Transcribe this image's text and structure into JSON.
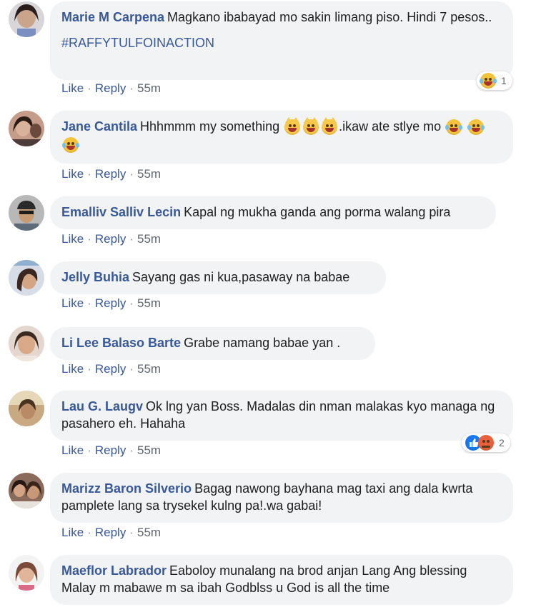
{
  "comments": [
    {
      "author": "Marie M Carpena",
      "text": "Magkano ibabayad mo sakin limang piso. Hindi 7 pesos..",
      "hashtag": "#RAFFYTULFOINACTION",
      "like": "Like",
      "reply": "Reply",
      "time": "55m",
      "reaction_count": "1"
    },
    {
      "author": "Jane Cantila",
      "text": "Hhhmmm my something",
      "text2": ".ikaw ate stlye mo",
      "like": "Like",
      "reply": "Reply",
      "time": "55m"
    },
    {
      "author": "Emalliv Salliv Lecin",
      "text": "Kapal ng mukha ganda ang porma walang pira",
      "like": "Like",
      "reply": "Reply",
      "time": "55m"
    },
    {
      "author": "Jelly Buhia",
      "text": "Sayang gas ni kua,pasaway na babae",
      "like": "Like",
      "reply": "Reply",
      "time": "55m"
    },
    {
      "author": "Li Lee Balaso Barte",
      "text": "Grabe namang babae yan .",
      "like": "Like",
      "reply": "Reply",
      "time": "55m"
    },
    {
      "author": "Lau G. Laugv",
      "text": "Ok lng yan Boss. Madalas din nman malakas kyo managa ng pasahero eh. Hahaha",
      "like": "Like",
      "reply": "Reply",
      "time": "55m",
      "reaction_count": "2"
    },
    {
      "author": "Marizz Baron Silverio",
      "text": "Bagag nawong bayhana mag taxi ang dala kwrta pamplete lang sa trysekel kulng pa!.wa gabai!",
      "like": "Like",
      "reply": "Reply",
      "time": "55m"
    },
    {
      "author": "Maeflor Labrador",
      "text": "Eaboloy munalang na brod anjan Lang Ang blessing Malay m mabawe m sa ibah Godblss u God is all the time"
    }
  ],
  "colors": {
    "link": "#385898",
    "bubble": "#f2f3f5",
    "text": "#1c1e21",
    "meta": "#616770"
  },
  "icons": {
    "haha": "haha-reaction-icon",
    "like": "like-reaction-icon",
    "angry": "angry-reaction-icon",
    "cat": "smiling-cat-icon"
  }
}
